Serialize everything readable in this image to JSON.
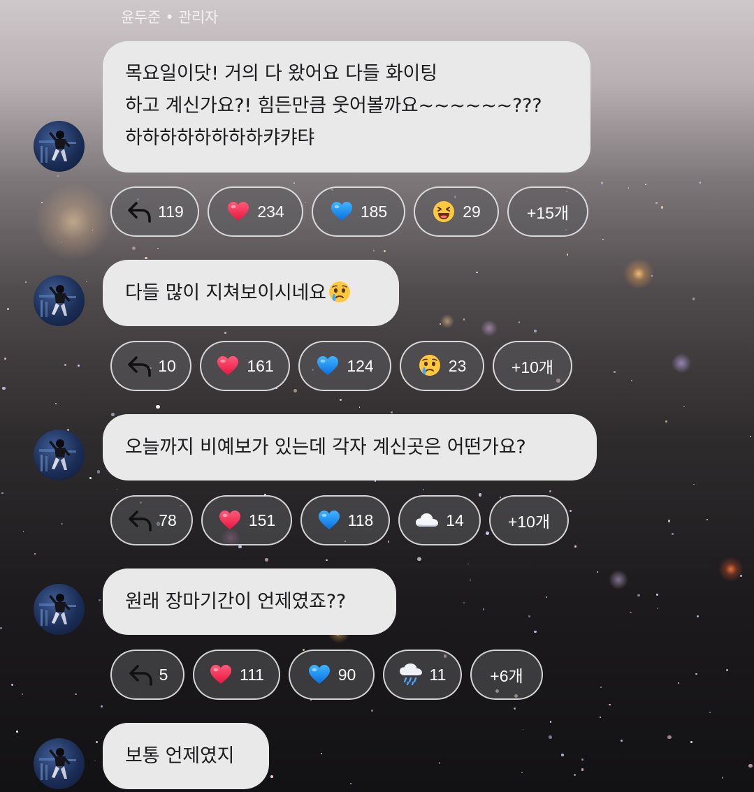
{
  "sender": {
    "name": "윤두준",
    "separator": "•",
    "role": "관리자"
  },
  "messages": [
    {
      "lines": [
        "목요일이닷! 거의 다 왔어요 다들 화이팅",
        "하고 계신가요?! 힘든만큼 웃어볼까요~~~~~~???",
        "하하하하하하하하캬캬탸"
      ],
      "reactions": {
        "reply": "119",
        "items": [
          {
            "icon": "red-heart-icon",
            "count": "234"
          },
          {
            "icon": "blue-heart-icon",
            "count": "185"
          },
          {
            "icon": "laughing-face-icon",
            "count": "29"
          }
        ],
        "more": "+15개"
      }
    },
    {
      "lines": [
        "다들 많이 지쳐보이시네요"
      ],
      "inline_emoji": "crying-face-icon",
      "reactions": {
        "reply": "10",
        "items": [
          {
            "icon": "red-heart-icon",
            "count": "161"
          },
          {
            "icon": "blue-heart-icon",
            "count": "124"
          },
          {
            "icon": "crying-face-icon",
            "count": "23"
          }
        ],
        "more": "+10개"
      }
    },
    {
      "lines": [
        "오늘까지 비예보가 있는데 각자 계신곳은 어떤가요?"
      ],
      "reactions": {
        "reply": "78",
        "items": [
          {
            "icon": "red-heart-icon",
            "count": "151"
          },
          {
            "icon": "blue-heart-icon",
            "count": "118"
          },
          {
            "icon": "cloud-icon",
            "count": "14"
          }
        ],
        "more": "+10개"
      }
    },
    {
      "lines": [
        "원래 장마기간이 언제였죠??"
      ],
      "reactions": {
        "reply": "5",
        "items": [
          {
            "icon": "red-heart-icon",
            "count": "111"
          },
          {
            "icon": "blue-heart-icon",
            "count": "90"
          },
          {
            "icon": "rain-cloud-icon",
            "count": "11"
          }
        ],
        "more": "+6개"
      }
    },
    {
      "lines": [
        "보통 언제였지"
      ]
    }
  ]
}
